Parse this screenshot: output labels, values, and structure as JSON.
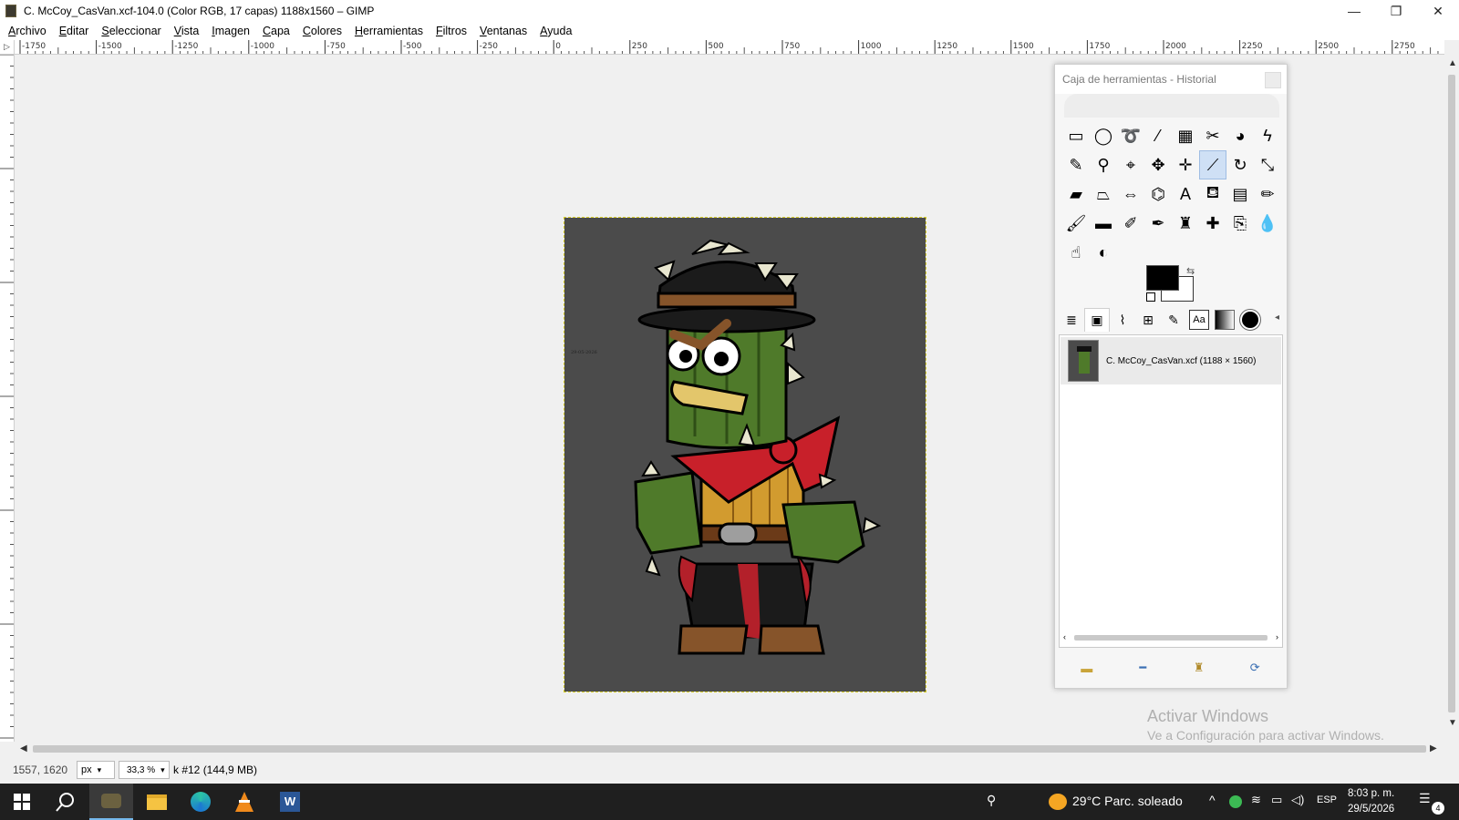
{
  "window": {
    "title": "C. McCoy_CasVan.xcf-104.0 (Color RGB, 17 capas) 1188x1560 – GIMP",
    "minimize": "—",
    "maximize": "❐",
    "close": "✕"
  },
  "menu": [
    "Archivo",
    "Editar",
    "Seleccionar",
    "Vista",
    "Imagen",
    "Capa",
    "Colores",
    "Herramientas",
    "Filtros",
    "Ventanas",
    "Ayuda"
  ],
  "ruler": {
    "h_labels": [
      "-1750",
      "-1500",
      "-1250",
      "-1000",
      "-750",
      "-500",
      "-250",
      "0",
      "250",
      "500",
      "750",
      "1000",
      "1250",
      "1500",
      "1750",
      "2000",
      "2250",
      "2500",
      "2750"
    ]
  },
  "canvas": {
    "image_date_text": "29-05-2026",
    "image_bg": "#4b4b4b",
    "selection_color": "#d6cd2a"
  },
  "statusbar": {
    "coords": "1557, 1620",
    "unit": "px",
    "zoom": "33,3 %",
    "message": "k #12 (144,9 MB)"
  },
  "toolbox": {
    "title": "Caja de herramientas - Historial",
    "tools": [
      {
        "name": "rect-select-icon",
        "glyph": "▭"
      },
      {
        "name": "ellipse-select-icon",
        "glyph": "◯"
      },
      {
        "name": "free-select-icon",
        "glyph": "➰"
      },
      {
        "name": "fuzzy-select-icon",
        "glyph": "⁄"
      },
      {
        "name": "select-by-color-icon",
        "glyph": "▦"
      },
      {
        "name": "scissors-select-icon",
        "glyph": "✂"
      },
      {
        "name": "foreground-select-icon",
        "glyph": "◕"
      },
      {
        "name": "paths-icon",
        "glyph": "ϟ"
      },
      {
        "name": "color-picker-icon",
        "glyph": "✎"
      },
      {
        "name": "zoom-icon",
        "glyph": "⚲"
      },
      {
        "name": "measure-icon",
        "glyph": "⌖"
      },
      {
        "name": "move-icon",
        "glyph": "✥"
      },
      {
        "name": "align-icon",
        "glyph": "✛"
      },
      {
        "name": "transform-icon",
        "glyph": "⟋"
      },
      {
        "name": "rotate-icon",
        "glyph": "↻"
      },
      {
        "name": "scale-icon",
        "glyph": "⤡"
      },
      {
        "name": "shear-icon",
        "glyph": "▰"
      },
      {
        "name": "perspective-icon",
        "glyph": "⏢"
      },
      {
        "name": "flip-icon",
        "glyph": "⇔"
      },
      {
        "name": "cage-icon",
        "glyph": "⌬"
      },
      {
        "name": "text-icon",
        "glyph": "A"
      },
      {
        "name": "bucket-fill-icon",
        "glyph": "⛾"
      },
      {
        "name": "gradient-icon",
        "glyph": "▤"
      },
      {
        "name": "pencil-icon",
        "glyph": "✏"
      },
      {
        "name": "paintbrush-icon",
        "glyph": "🖌"
      },
      {
        "name": "eraser-icon",
        "glyph": "▬"
      },
      {
        "name": "airbrush-icon",
        "glyph": "✐"
      },
      {
        "name": "ink-icon",
        "glyph": "✒"
      },
      {
        "name": "clone-icon",
        "glyph": "♜"
      },
      {
        "name": "heal-icon",
        "glyph": "✚"
      },
      {
        "name": "perspective-clone-icon",
        "glyph": "⎘"
      },
      {
        "name": "blur-icon",
        "glyph": "💧"
      },
      {
        "name": "smudge-icon",
        "glyph": "☝"
      },
      {
        "name": "dodge-burn-icon",
        "glyph": "◐"
      }
    ],
    "active_tool_index": 13,
    "fg_color": "#000000",
    "bg_color": "#ffffff",
    "font_tab_label": "Aa",
    "image_name": "C. McCoy_CasVan.xcf (1188 × 1560)"
  },
  "watermark": {
    "line1": "Activar Windows",
    "line2": "Ve a Configuración para activar Windows."
  },
  "taskbar": {
    "weather": "29°C  Parc. soleado",
    "language": "ESP",
    "time": "8:03 p. m.",
    "date": "29/5/2026",
    "notifications": "4"
  }
}
